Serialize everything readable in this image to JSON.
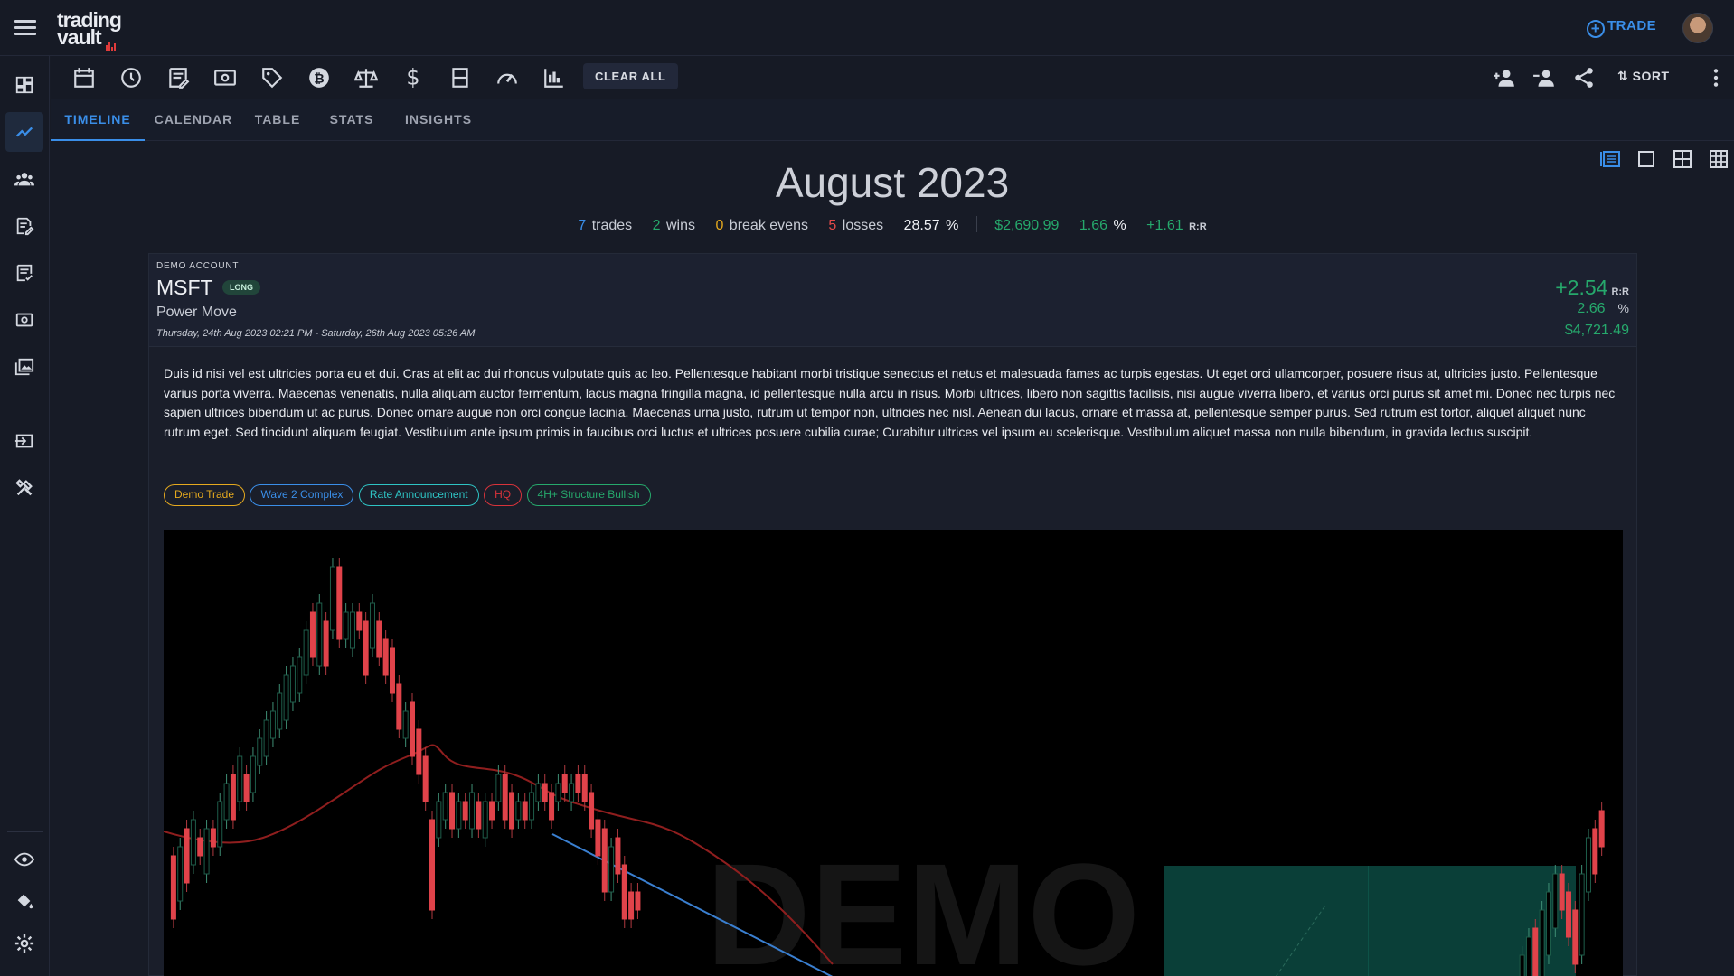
{
  "app": {
    "logo_line1": "trading",
    "logo_line2": "vault",
    "trade_button": "TRADE"
  },
  "sidebar": {
    "items": [
      {
        "icon": "dashboard-icon",
        "active": false
      },
      {
        "icon": "trend-chart-icon",
        "active": true
      },
      {
        "icon": "community-icon",
        "active": false
      },
      {
        "icon": "edit-document-icon",
        "active": false
      },
      {
        "icon": "checklist-icon",
        "active": false
      },
      {
        "icon": "money-icon",
        "active": false
      },
      {
        "icon": "gallery-icon",
        "active": false
      },
      {
        "icon": "import-icon",
        "active": false
      },
      {
        "icon": "tools-icon",
        "active": false
      },
      {
        "icon": "eye-icon",
        "active": false
      },
      {
        "icon": "paint-bucket-icon",
        "active": false
      },
      {
        "icon": "settings-gear-icon",
        "active": false
      }
    ]
  },
  "toolbar": {
    "filter_icons": [
      "calendar-icon",
      "clock-icon",
      "notes-icon",
      "cash-icon",
      "tag-icon",
      "bitcoin-icon",
      "scale-icon",
      "dollar-icon",
      "rect-icon",
      "speedometer-icon",
      "bar-chart-icon"
    ],
    "clear_all_label": "CLEAR ALL",
    "right_icons": [
      "add-person-icon",
      "remove-person-icon",
      "share-icon"
    ],
    "sort_label": "SORT"
  },
  "tabs": [
    {
      "label": "TIMELINE",
      "active": true
    },
    {
      "label": "CALENDAR",
      "active": false
    },
    {
      "label": "TABLE",
      "active": false
    },
    {
      "label": "STATS",
      "active": false
    },
    {
      "label": "INSIGHTS",
      "active": false
    }
  ],
  "view_modes": [
    "list-view-icon",
    "single-view-icon",
    "grid2-view-icon",
    "grid3-view-icon"
  ],
  "header": {
    "title": "August 2023",
    "trades_count": "7",
    "trades_label": "trades",
    "wins_count": "2",
    "wins_label": "wins",
    "breakeven_count": "0",
    "breakeven_label": "break evens",
    "losses_count": "5",
    "losses_label": "losses",
    "winrate_value": "28.57",
    "winrate_unit": "%",
    "pnl": "$2,690.99",
    "return_value": "1.66",
    "return_unit": "%",
    "rr_value": "+1.61",
    "rr_unit": "R:R"
  },
  "trade": {
    "account_label": "DEMO ACCOUNT",
    "ticker": "MSFT",
    "direction": "LONG",
    "setup": "Power Move",
    "date_range": "Thursday, 24th Aug 2023 02:21 PM - Saturday, 26th Aug 2023 05:26 AM",
    "rr_value": "+2.54",
    "rr_unit": "R:R",
    "pct_value": "2.66",
    "pct_unit": "%",
    "pnl": "$4,721.49",
    "notes": "Duis id nisi vel est ultricies porta eu et dui. Cras at elit ac dui rhoncus vulputate quis ac leo. Pellentesque habitant morbi tristique senectus et netus et malesuada fames ac turpis egestas. Ut eget orci ullamcorper, posuere risus at, ultricies justo. Pellentesque varius porta viverra. Maecenas venenatis, nulla aliquam auctor fermentum, lacus magna fringilla magna, id pellentesque nulla arcu in risus. Morbi ultrices, libero non sagittis facilisis, nisi augue viverra libero, et varius orci purus sit amet mi. Donec nec turpis nec sapien ultrices bibendum ut ac purus. Donec ornare augue non orci congue lacinia. Maecenas urna justo, rutrum ut tempor non, ultricies nec nisl. Aenean dui lacus, ornare et massa at, pellentesque semper purus. Sed rutrum est tortor, aliquet aliquet nunc rutrum eget. Sed tincidunt aliquam feugiat. Vestibulum ante ipsum primis in faucibus orci luctus et ultrices posuere cubilia curae; Curabitur ultrices vel ipsum eu scelerisque. Vestibulum aliquet massa non nulla bibendum, in gravida lectus suscipit.",
    "tags": [
      {
        "label": "Demo Trade",
        "color": "#e5a91e"
      },
      {
        "label": "Wave 2 Complex",
        "color": "#3a8ee8"
      },
      {
        "label": "Rate Announcement",
        "color": "#2ec4c4"
      },
      {
        "label": "HQ",
        "color": "#d8333a"
      },
      {
        "label": "4H+ Structure Bullish",
        "color": "#26a96c"
      }
    ],
    "screenshot_watermark": "DEMO"
  },
  "colors": {
    "accent": "#3a8ee8",
    "win": "#26a96c",
    "loss": "#e44a4a",
    "breakeven": "#e5a91e",
    "background": "#171b26"
  }
}
